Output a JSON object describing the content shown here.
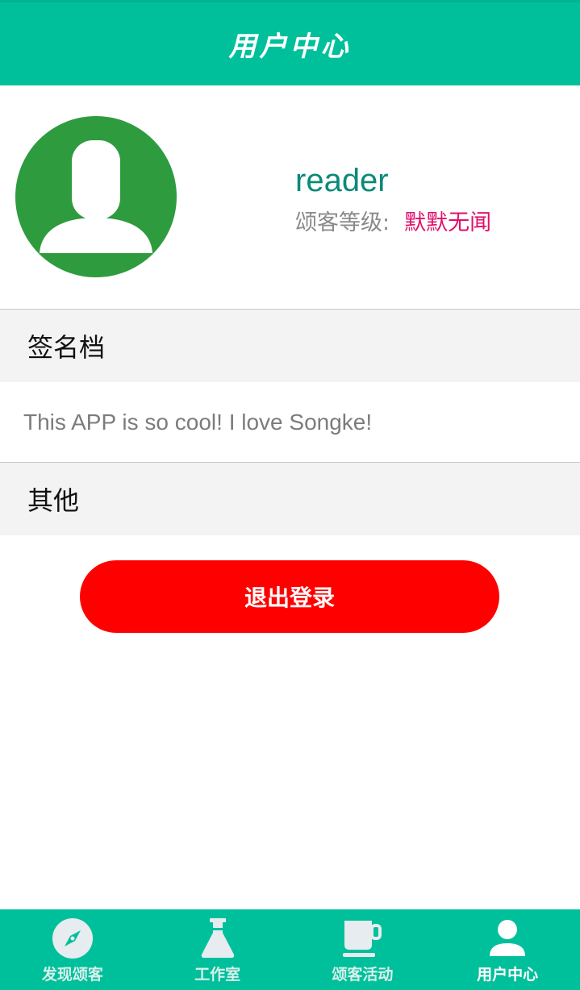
{
  "header": {
    "title": "用户中心"
  },
  "profile": {
    "username": "reader",
    "level_label": "颂客等级:",
    "level_value": "默默无闻"
  },
  "sections": {
    "signature_title": "签名档",
    "signature_text": "This APP is so cool! I love Songke!",
    "other_title": "其他"
  },
  "actions": {
    "logout_label": "退出登录"
  },
  "bottom_nav": {
    "items": [
      {
        "label": "发现颂客",
        "icon": "compass-icon"
      },
      {
        "label": "工作室",
        "icon": "flask-icon"
      },
      {
        "label": "颂客活动",
        "icon": "coffee-cup-icon"
      },
      {
        "label": "用户中心",
        "icon": "user-icon"
      }
    ],
    "active_index": 3
  },
  "colors": {
    "primary": "#00c09c",
    "avatar_bg": "#2e9b3f",
    "username": "#0b8a79",
    "level_value": "#e0106a",
    "logout": "#ff0000"
  }
}
